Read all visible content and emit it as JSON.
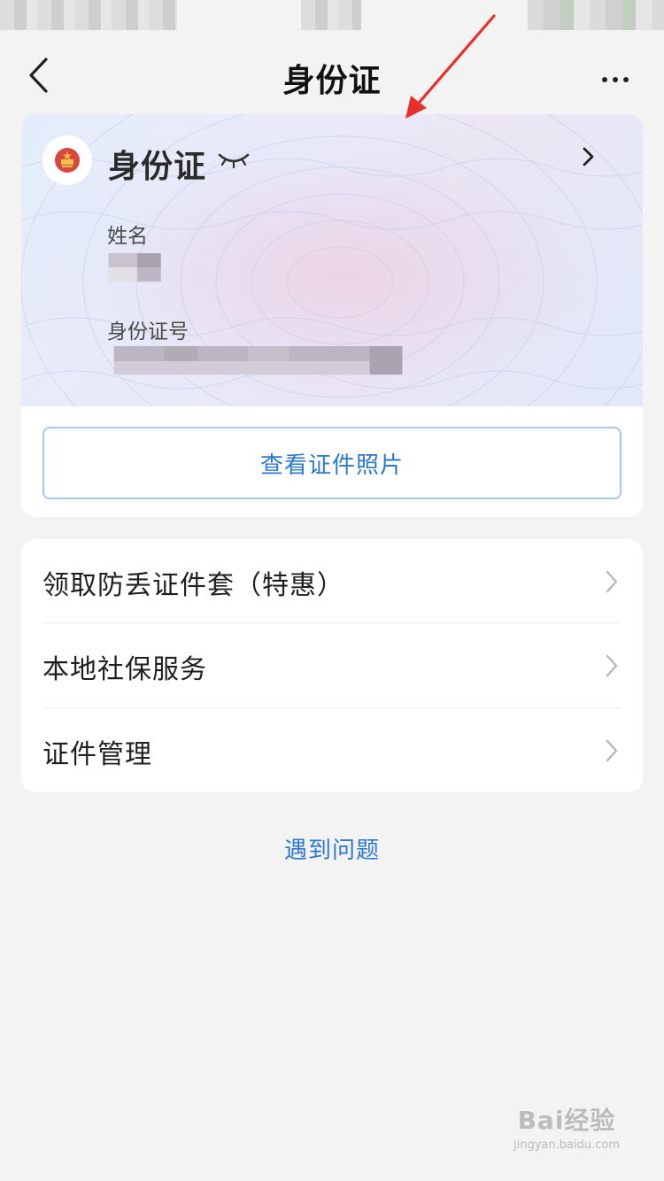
{
  "nav": {
    "title": "身份证"
  },
  "id_card": {
    "title": "身份证",
    "name_label": "姓名",
    "id_label": "身份证号",
    "view_photo_button": "查看证件照片"
  },
  "services": [
    {
      "label": "领取防丢证件套（特惠）"
    },
    {
      "label": "本地社保服务"
    },
    {
      "label": "证件管理"
    }
  ],
  "help_link": "遇到问题",
  "watermark": {
    "main": "Bai经验",
    "sub": "jingyan.baidu.com"
  },
  "colors": {
    "accent": "#2d78d2",
    "annotation_arrow": "#e8302a",
    "emblem_red": "#d8463d"
  },
  "icons": {
    "back": "chevron-left-icon",
    "more": "more-dots-icon",
    "eye": "eye-closed-icon",
    "chevron": "chevron-right-icon",
    "emblem": "national-emblem-icon"
  }
}
